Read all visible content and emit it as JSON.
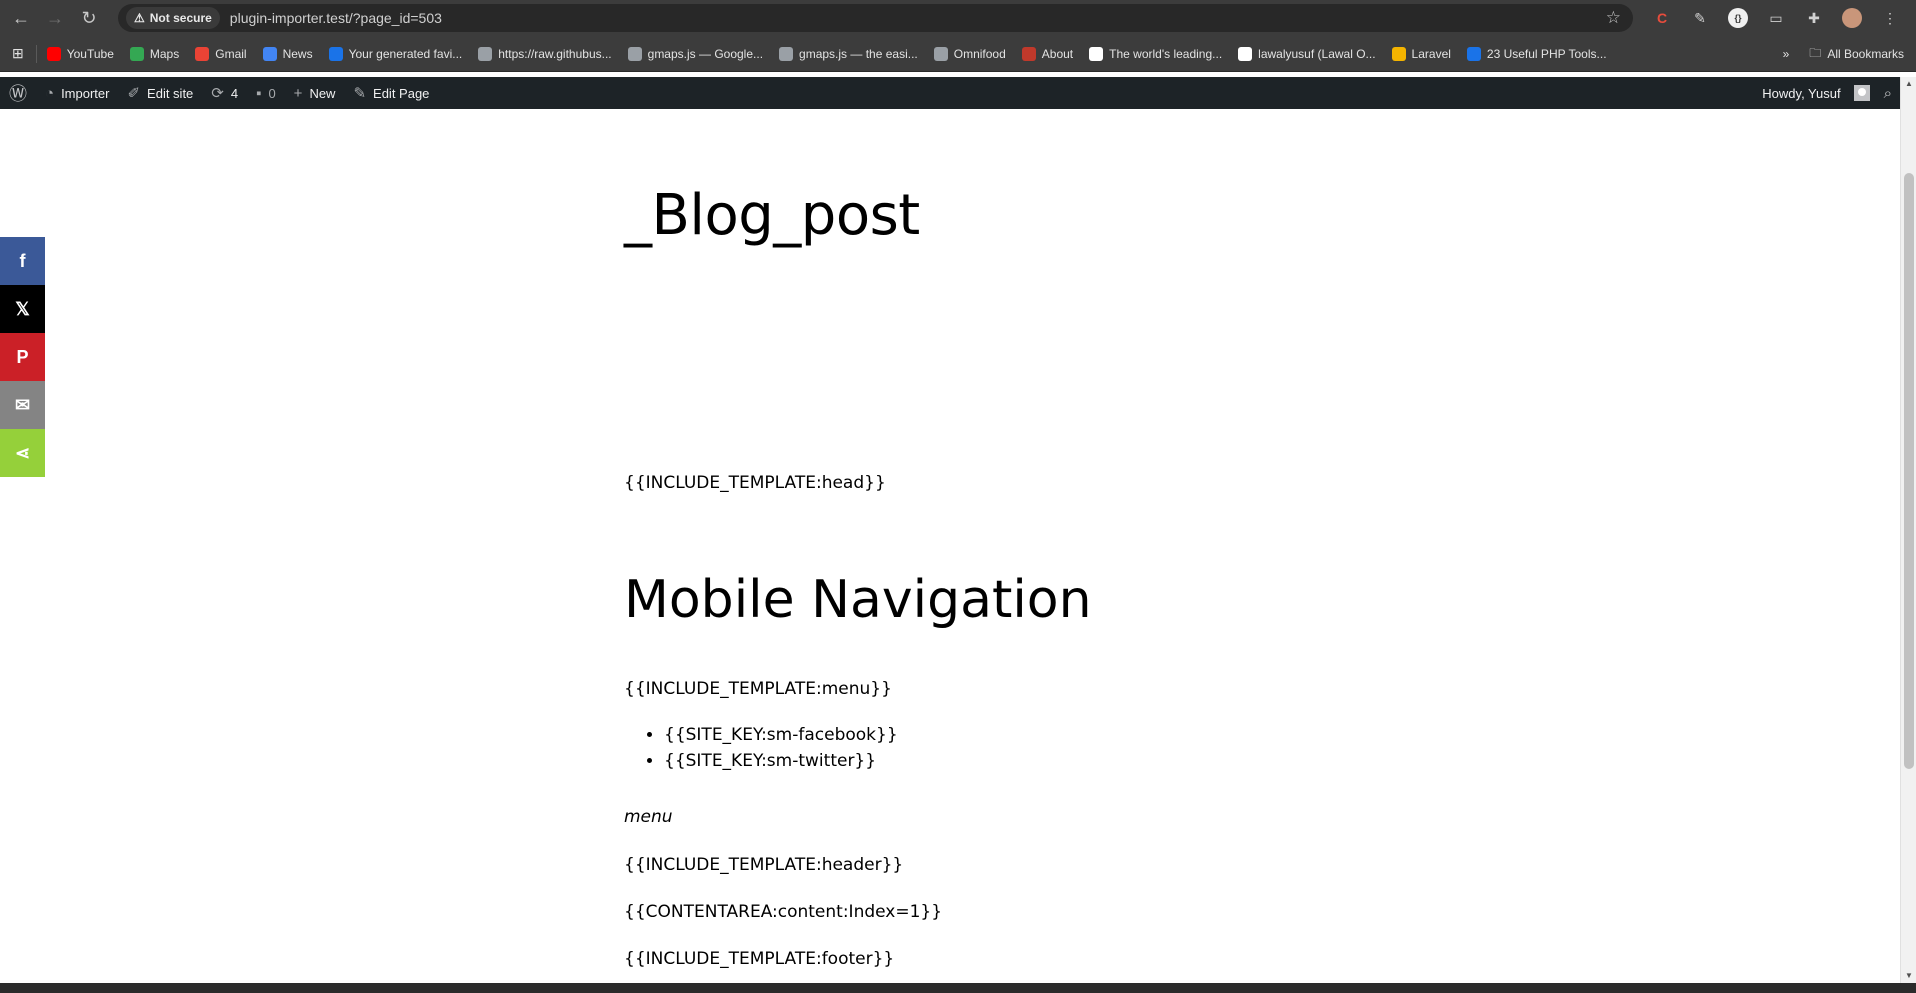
{
  "browser": {
    "security_label": "Not secure",
    "url": "plugin-importer.test/?page_id=503",
    "bookmarks": [
      {
        "label": "YouTube",
        "color": "#ff0000"
      },
      {
        "label": "Maps",
        "color": "#34a853"
      },
      {
        "label": "Gmail",
        "color": "#ea4335"
      },
      {
        "label": "News",
        "color": "#4285f4"
      },
      {
        "label": "Your generated favi...",
        "color": "#1a73e8"
      },
      {
        "label": "https://raw.githubus...",
        "color": "#9aa0a6"
      },
      {
        "label": "gmaps.js — Google...",
        "color": "#9aa0a6"
      },
      {
        "label": "gmaps.js — the easi...",
        "color": "#9aa0a6"
      },
      {
        "label": "Omnifood",
        "color": "#9aa0a6"
      },
      {
        "label": "About",
        "color": "#c0392b"
      },
      {
        "label": "The world's leading...",
        "color": "#ffffff"
      },
      {
        "label": "lawalyusuf (Lawal O...",
        "color": "#ffffff"
      },
      {
        "label": "Laravel",
        "color": "#f4b400"
      },
      {
        "label": "23 Useful PHP Tools...",
        "color": "#1a73e8"
      }
    ],
    "all_bookmarks_label": "All Bookmarks"
  },
  "wpbar": {
    "importer_label": "Importer",
    "edit_site_label": "Edit site",
    "updates_count": "4",
    "comments_count": "0",
    "new_label": "New",
    "edit_page_label": "Edit Page",
    "howdy_label": "Howdy, Yusuf"
  },
  "share": [
    {
      "name": "facebook",
      "glyph": "f",
      "color": "#3b5998"
    },
    {
      "name": "x",
      "glyph": "𝕏",
      "color": "#000000"
    },
    {
      "name": "pinterest",
      "glyph": "P",
      "color": "#cb2027"
    },
    {
      "name": "email",
      "glyph": "✉",
      "color": "#848484"
    },
    {
      "name": "share",
      "glyph": "⋖",
      "color": "#95d03a"
    }
  ],
  "content": {
    "title": "_Blog_post",
    "include_head": "{{INCLUDE_TEMPLATE:head}}",
    "heading": "Mobile Navigation",
    "include_menu": "{{INCLUDE_TEMPLATE:menu}}",
    "list": [
      "{{SITE_KEY:sm-facebook}}",
      "{{SITE_KEY:sm-twitter}}"
    ],
    "menu_italic": "menu",
    "include_header": "{{INCLUDE_TEMPLATE:header}}",
    "content_area": "{{CONTENTAREA:content:Index=1}}",
    "include_footer": "{{INCLUDE_TEMPLATE:footer}}"
  }
}
